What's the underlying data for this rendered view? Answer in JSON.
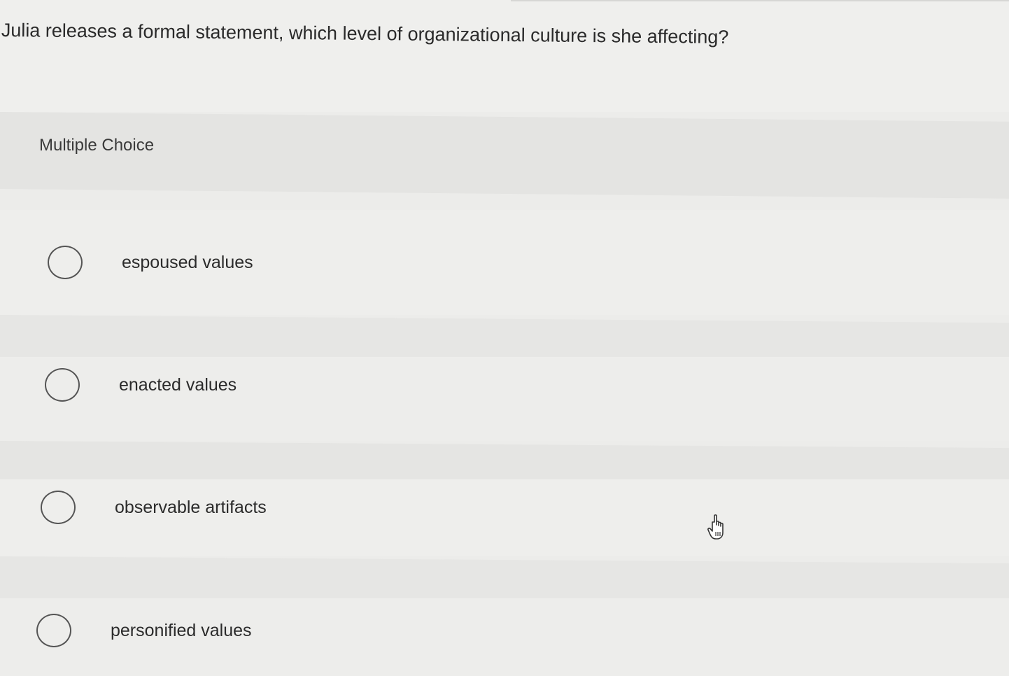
{
  "question": {
    "text": "Julia releases a formal statement, which level of organizational culture is she affecting?"
  },
  "section": {
    "label": "Multiple Choice"
  },
  "options": [
    {
      "label": "espoused values",
      "selected": false
    },
    {
      "label": "enacted values",
      "selected": false
    },
    {
      "label": "observable artifacts",
      "selected": false
    },
    {
      "label": "personified values",
      "selected": false
    }
  ],
  "cursor": {
    "icon": "hand-pointer-icon"
  }
}
